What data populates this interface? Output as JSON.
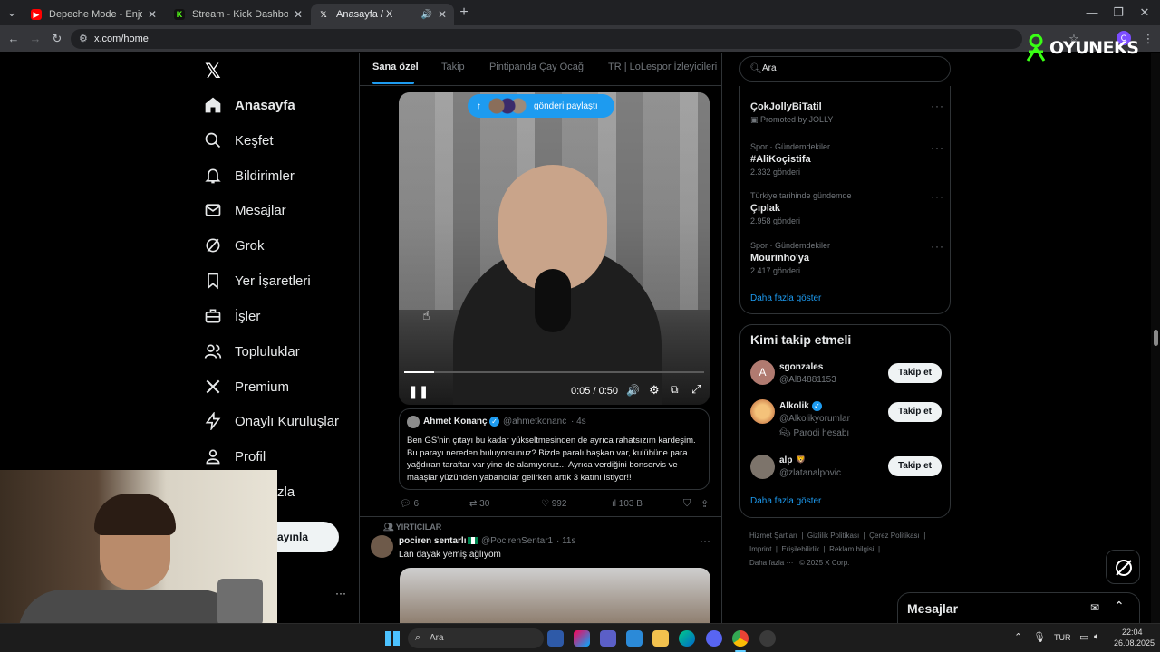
{
  "browser": {
    "tabs": [
      {
        "title": "Depeche Mode - Enjoy The Sile",
        "fav_color": "#ff0000"
      },
      {
        "title": "Stream - Kick Dashboard",
        "fav_color": "#53fc18"
      },
      {
        "title": "Anasayfa / X",
        "fav_color": "#ffffff"
      }
    ],
    "url": "x.com/home"
  },
  "overlay": {
    "brand": "OYUNEKS"
  },
  "nav": {
    "items": [
      {
        "label": "Anasayfa",
        "icon": "home-icon"
      },
      {
        "label": "Keşfet",
        "icon": "search-icon"
      },
      {
        "label": "Bildirimler",
        "icon": "bell-icon"
      },
      {
        "label": "Mesajlar",
        "icon": "mail-icon"
      },
      {
        "label": "Grok",
        "icon": "grok-icon"
      },
      {
        "label": "Yer İşaretleri",
        "icon": "bookmark-icon"
      },
      {
        "label": "İşler",
        "icon": "briefcase-icon"
      },
      {
        "label": "Topluluklar",
        "icon": "people-icon"
      },
      {
        "label": "Premium",
        "icon": "x-logo-icon"
      },
      {
        "label": "Onaylı Kuruluşlar",
        "icon": "lightning-icon"
      },
      {
        "label": "Profil",
        "icon": "person-icon"
      },
      {
        "label": "zla",
        "icon": ""
      }
    ],
    "post_button": "ayınla"
  },
  "feed": {
    "tabs": [
      "Sana özel",
      "Takip",
      "Pintipanda Çay Ocağı",
      "TR | LoLespor İzleyicileri"
    ],
    "share_pill": "gönderi paylaştı",
    "video": {
      "time": "0:05 / 0:50",
      "progress": 0.1
    },
    "tweet": {
      "author": "Ahmet Konanç",
      "handle": "@ahmetkonanc",
      "age": "· 4s",
      "text": "Ben GS'nin çıtayı bu kadar yükseltmesinden de ayrıca rahatsızım kardeşim. Bu parayı nereden buluyorsunuz? Bizde paralı başkan var, kulübüne para yağdıran taraftar var yine de alamıyoruz... Ayrıca verdiğini bonservis ve maaşlar yüzünden yabancılar gelirken artık 3 katını istiyor!!",
      "replies": "6",
      "retweets": "30",
      "likes": "992",
      "views": "103 B"
    },
    "tweet2": {
      "context": "YIRTICILAR",
      "author": "pociren sentarlı",
      "handle": "@PocirenSentar1",
      "age": "· 11s",
      "text": "Lan dayak yemiş ağlıyom"
    }
  },
  "right": {
    "search_placeholder": "Ara",
    "trends": [
      {
        "meta": "",
        "name": "ÇokJollyBiTatil",
        "count": "Promoted by JOLLY"
      },
      {
        "meta": "Spor · Gündemdekiler",
        "name": "#AliKoçistifa",
        "count": "2.332 gönderi"
      },
      {
        "meta": "Türkiye tarihinde gündemde",
        "name": "Çıplak",
        "count": "2.958 gönderi"
      },
      {
        "meta": "Spor · Gündemdekiler",
        "name": "Mourinho'ya",
        "count": "2.417 gönderi"
      }
    ],
    "show_more": "Daha fazla göster",
    "who_to_follow": {
      "title": "Kimi takip etmeli",
      "people": [
        {
          "name": "sgonzales",
          "handle": "@Al84881153",
          "note": "",
          "avatar": "A"
        },
        {
          "name": "Alkolik",
          "handle": "@Alkolikyorumlar",
          "note": "Parodi hesabı",
          "avatar": ""
        },
        {
          "name": "alp",
          "handle": "@zlatanalpovic",
          "note": "",
          "avatar": ""
        }
      ],
      "follow_label": "Takip et",
      "show_more": "Daha fazla göster"
    },
    "footer": {
      "line1": "Hizmet Şartları  |  Gizlilik Politikası  |  Çerez Politikası  |",
      "line2": "Imprint  |  Erişilebilirlik  |  Reklam bilgisi  |",
      "line3": "Daha fazla ···   © 2025 X Corp."
    },
    "messages_title": "Mesajlar"
  },
  "taskbar": {
    "search": "Ara",
    "lang": "TUR",
    "time": "22:04",
    "date": "26.08.2025"
  },
  "colors": {
    "accent": "#1d9bf0",
    "bg": "#000000",
    "border": "#2f3336"
  }
}
